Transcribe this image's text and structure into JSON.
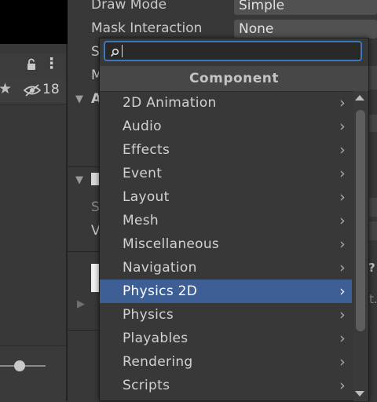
{
  "hierarchy": {
    "lock_icon_label": "lock",
    "menu_icon": "⋮",
    "star_icon": "★",
    "hidden_count": "18"
  },
  "inspector": {
    "rows": [
      {
        "label": "Draw Mode",
        "value": "Simple"
      },
      {
        "label": "Mask Interaction",
        "value": "None"
      }
    ],
    "partial_labels": [
      "S",
      "M",
      "A",
      "S",
      "V"
    ],
    "right_fragments": [
      "?",
      "t."
    ]
  },
  "popup": {
    "search": {
      "value": "",
      "placeholder": ""
    },
    "header": "Component",
    "items": [
      {
        "label": "2D Animation",
        "selected": false
      },
      {
        "label": "Audio",
        "selected": false
      },
      {
        "label": "Effects",
        "selected": false
      },
      {
        "label": "Event",
        "selected": false
      },
      {
        "label": "Layout",
        "selected": false
      },
      {
        "label": "Mesh",
        "selected": false
      },
      {
        "label": "Miscellaneous",
        "selected": false
      },
      {
        "label": "Navigation",
        "selected": false
      },
      {
        "label": "Physics 2D",
        "selected": true
      },
      {
        "label": "Physics",
        "selected": false
      },
      {
        "label": "Playables",
        "selected": false
      },
      {
        "label": "Rendering",
        "selected": false
      },
      {
        "label": "Scripts",
        "selected": false
      }
    ],
    "chevron": "›"
  },
  "colors": {
    "selection": "#3e5f96",
    "search_focus": "#3a79bb",
    "background": "#383838"
  }
}
